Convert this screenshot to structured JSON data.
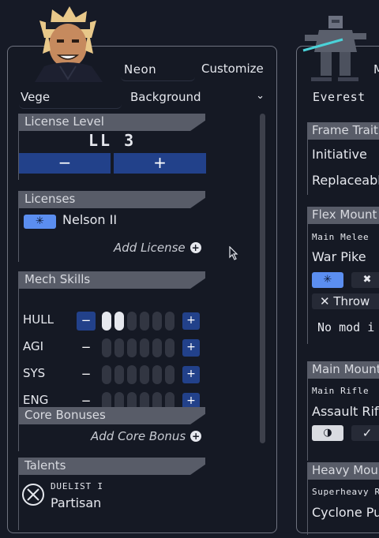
{
  "pilot": {
    "callsign": "Neon",
    "customize_label": "Customize",
    "frame_select": "Vege",
    "background_select": "Background",
    "license_level": {
      "heading": "License Level",
      "value": "LL 3",
      "decrement": "−",
      "increment": "+"
    },
    "licenses": {
      "heading": "Licenses",
      "items": [
        {
          "name": "Nelson II"
        }
      ],
      "add_label": "Add License"
    },
    "mech_skills": {
      "heading": "Mech Skills",
      "rows": [
        {
          "name": "HULL",
          "value": 2,
          "max": 6
        },
        {
          "name": "AGI",
          "value": 0,
          "max": 6
        },
        {
          "name": "SYS",
          "value": 0,
          "max": 6
        },
        {
          "name": "ENG",
          "value": 0,
          "max": 6
        }
      ],
      "minus": "−",
      "plus": "+"
    },
    "core_bonuses": {
      "heading": "Core Bonuses",
      "add_label": "Add Core Bonus"
    },
    "talents": {
      "heading": "Talents",
      "items": [
        {
          "tier": "DUELIST I",
          "name": "Partisan"
        }
      ]
    }
  },
  "mech": {
    "name_stub": "M",
    "frame": "Everest",
    "frame_traits": {
      "heading": "Frame Trait",
      "items": [
        "Initiative",
        "Replaceable"
      ]
    },
    "flex_mount": {
      "heading": "Flex Mount",
      "slot": "Main Melee",
      "weapon": "War Pike",
      "throw_label": "Throw",
      "mod_label": "No mod i"
    },
    "main_mount": {
      "heading": "Main Mount",
      "slot": "Main Rifle",
      "weapon": "Assault Rifle"
    },
    "heavy_mount": {
      "heading": "Heavy Mou",
      "slot": "Superheavy R",
      "weapon": "Cyclone Pul"
    }
  },
  "colors": {
    "background": "#161a26",
    "panel_border": "#6f7380",
    "section_header": "#585c68",
    "accent_blue": "#22418a",
    "license_chip": "#5b8ef0"
  }
}
